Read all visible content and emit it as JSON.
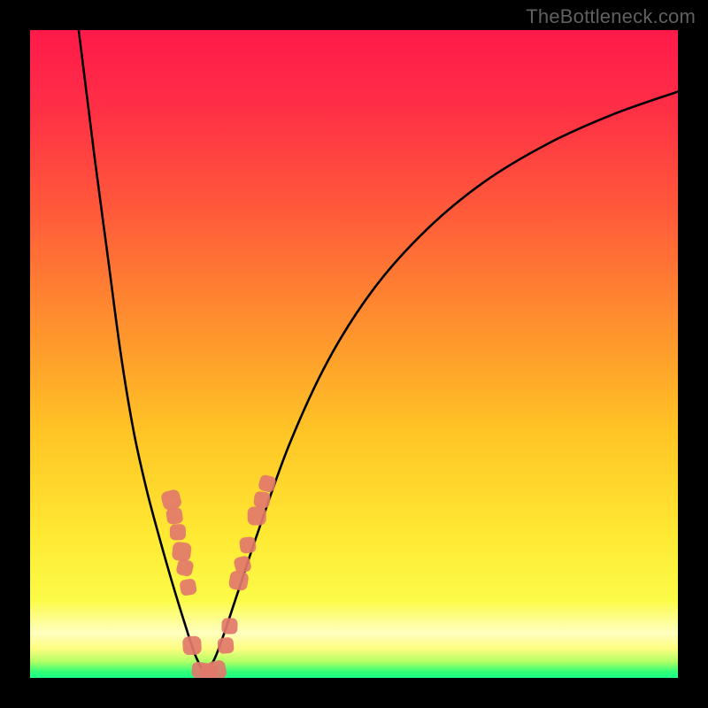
{
  "watermark": {
    "text": "TheBottleneck.com"
  },
  "colors": {
    "background": "#000000",
    "gradient_stops": [
      {
        "offset": 0.0,
        "color": "#ff1a4a"
      },
      {
        "offset": 0.12,
        "color": "#ff2f46"
      },
      {
        "offset": 0.28,
        "color": "#ff5a3a"
      },
      {
        "offset": 0.45,
        "color": "#ff8f2e"
      },
      {
        "offset": 0.62,
        "color": "#ffc425"
      },
      {
        "offset": 0.78,
        "color": "#ffe933"
      },
      {
        "offset": 0.88,
        "color": "#fbfb48"
      },
      {
        "offset": 0.93,
        "color": "#ffffc0"
      },
      {
        "offset": 0.955,
        "color": "#fdfd80"
      },
      {
        "offset": 0.975,
        "color": "#b2ff66"
      },
      {
        "offset": 0.99,
        "color": "#33ff77"
      },
      {
        "offset": 1.0,
        "color": "#1aff88"
      }
    ],
    "curve_stroke": "#000000",
    "marker_fill": "#e2786b",
    "marker_stroke": "#cf5f52"
  },
  "chart_data": {
    "type": "line",
    "title": "",
    "xlabel": "",
    "ylabel": "",
    "xlim": [
      0,
      100
    ],
    "ylim": [
      0,
      100
    ],
    "optimum_x": 27,
    "series": [
      {
        "name": "left-branch",
        "x": [
          7.5,
          8.5,
          10,
          12,
          14,
          16,
          18,
          20,
          22,
          24,
          25.5,
          27
        ],
        "y": [
          100,
          92,
          80,
          65,
          50,
          38,
          29,
          21.5,
          14.5,
          8,
          3.5,
          0.5
        ]
      },
      {
        "name": "right-branch",
        "x": [
          27,
          28.5,
          30,
          32,
          35,
          40,
          46,
          53,
          61,
          70,
          80,
          90,
          100
        ],
        "y": [
          0.5,
          3,
          7,
          13,
          22,
          36,
          49,
          60,
          69,
          76.5,
          82.5,
          87,
          90.5
        ]
      }
    ],
    "markers": {
      "name": "highlighted-points",
      "points": [
        {
          "x": 21.8,
          "y": 27.5
        },
        {
          "x": 22.3,
          "y": 25.0
        },
        {
          "x": 22.8,
          "y": 22.5
        },
        {
          "x": 23.4,
          "y": 19.5
        },
        {
          "x": 23.9,
          "y": 17.0
        },
        {
          "x": 24.4,
          "y": 14.0
        },
        {
          "x": 25.0,
          "y": 5.0
        },
        {
          "x": 26.2,
          "y": 1.2
        },
        {
          "x": 27.6,
          "y": 1.0
        },
        {
          "x": 28.8,
          "y": 1.2
        },
        {
          "x": 30.2,
          "y": 5.0
        },
        {
          "x": 30.8,
          "y": 8.0
        },
        {
          "x": 32.2,
          "y": 15.0
        },
        {
          "x": 32.8,
          "y": 17.5
        },
        {
          "x": 33.6,
          "y": 20.5
        },
        {
          "x": 35.0,
          "y": 25.0
        },
        {
          "x": 35.8,
          "y": 27.5
        },
        {
          "x": 36.6,
          "y": 30.0
        }
      ]
    }
  }
}
